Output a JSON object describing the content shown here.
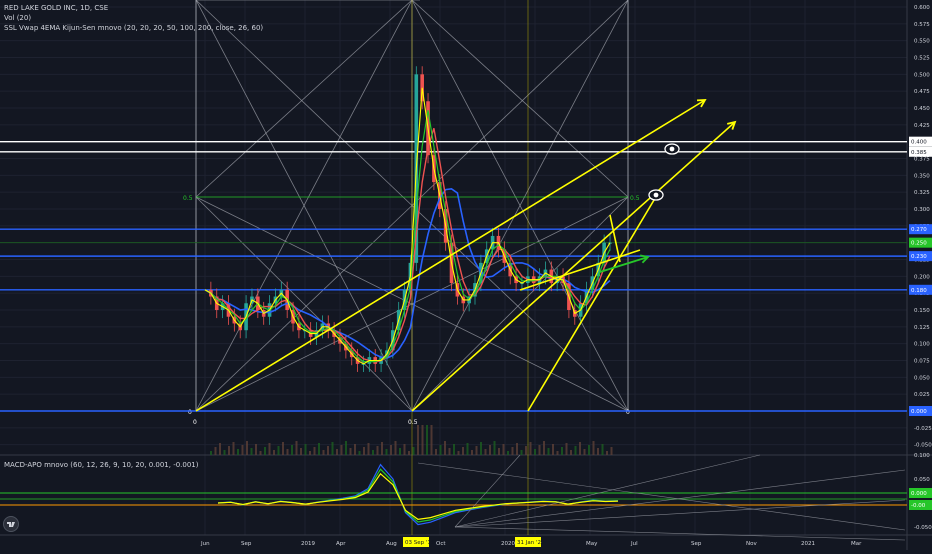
{
  "header": {
    "symbol_line": "RED LAKE GOLD INC, 1D, CSE",
    "vol_line": "Vol (20)",
    "ssl_line": "SSL Vwap 4EMA Kijun-Sen mnovo (20, 20, 20, 50, 100, 200, close, 26, 60)",
    "macd_line": "MACD-APO mnovo (60, 12, 26, 9, 10, 20, 0.001, -0.001)"
  },
  "colors": {
    "background": "#131722",
    "grid": "#1e2230",
    "blue_line": "#2962ff",
    "white_line": "#ffffff",
    "yellow": "#ffff00",
    "green": "#26c629",
    "red": "#ef5350",
    "price_green": "#26a69a"
  },
  "chart_data": [
    {
      "type": "line",
      "title": "RED LAKE GOLD INC, 1D, CSE",
      "y_axis": {
        "ticks": [
          "0.600",
          "0.575",
          "0.550",
          "0.525",
          "0.500",
          "0.475",
          "0.450",
          "0.425",
          "0.400",
          "0.375",
          "0.350",
          "0.325",
          "0.300",
          "0.275",
          "0.250",
          "0.225",
          "0.200",
          "0.175",
          "0.150",
          "0.125",
          "0.100",
          "0.075",
          "0.050",
          "0.025",
          "0.000",
          "-0.025",
          "-0.050"
        ],
        "ylim": [
          -0.05,
          0.6
        ]
      },
      "x_axis": {
        "ticks": [
          "Jun",
          "Sep",
          "2019",
          "Apr",
          "Aug",
          "Oct",
          "2020",
          "Mar",
          "May",
          "Jul",
          "Sep",
          "Nov",
          "2021",
          "Mar"
        ],
        "highlight_labels": [
          "03 Sep '19",
          "31 Jan '20"
        ]
      },
      "price_labels": {
        "levels": [
          {
            "label": "0.400",
            "value": 0.4,
            "style": "white"
          },
          {
            "label": "0.385",
            "value": 0.385,
            "style": "white"
          },
          {
            "label": "0.270",
            "value": 0.27,
            "style": "blue"
          },
          {
            "label": "0.250",
            "value": 0.25,
            "style": "green"
          },
          {
            "label": "0.230",
            "value": 0.23,
            "style": "blue"
          },
          {
            "label": "0.180",
            "value": 0.18,
            "style": "blue"
          },
          {
            "label": "0.000",
            "value": 0.0,
            "style": "blue"
          }
        ]
      },
      "fib_labels": {
        "zero_left": "0",
        "half": "0.5",
        "zero_right": "0",
        "half_level": "0.5",
        "half_level_right": "0.5"
      },
      "series": [
        {
          "name": "close",
          "values": [
            0.18,
            0.17,
            0.15,
            0.16,
            0.14,
            0.13,
            0.12,
            0.16,
            0.17,
            0.15,
            0.14,
            0.16,
            0.17,
            0.18,
            0.15,
            0.13,
            0.12,
            0.12,
            0.11,
            0.12,
            0.13,
            0.12,
            0.11,
            0.1,
            0.09,
            0.08,
            0.07,
            0.07,
            0.08,
            0.07,
            0.08,
            0.09,
            0.12,
            0.15,
            0.18,
            0.22,
            0.5,
            0.46,
            0.38,
            0.34,
            0.3,
            0.25,
            0.19,
            0.17,
            0.16,
            0.17,
            0.19,
            0.22,
            0.24,
            0.26,
            0.24,
            0.22,
            0.2,
            0.19,
            0.19,
            0.2,
            0.19,
            0.2,
            0.21,
            0.19,
            0.2,
            0.19,
            0.15,
            0.14,
            0.16,
            0.18,
            0.2,
            0.22,
            0.25,
            0.25
          ]
        }
      ]
    },
    {
      "type": "line",
      "title": "MACD-APO mnovo (60, 12, 26, 9, 10, 20, 0.001, -0.001)",
      "y_axis": {
        "ticks": [
          "0.100",
          "0.050",
          "0.000",
          "-0.050"
        ],
        "ylim": [
          -0.06,
          0.1
        ]
      },
      "badges": [
        {
          "label": "0.000",
          "color": "#26c629"
        },
        {
          "label": "-0.00",
          "color": "#26c629"
        }
      ]
    }
  ]
}
